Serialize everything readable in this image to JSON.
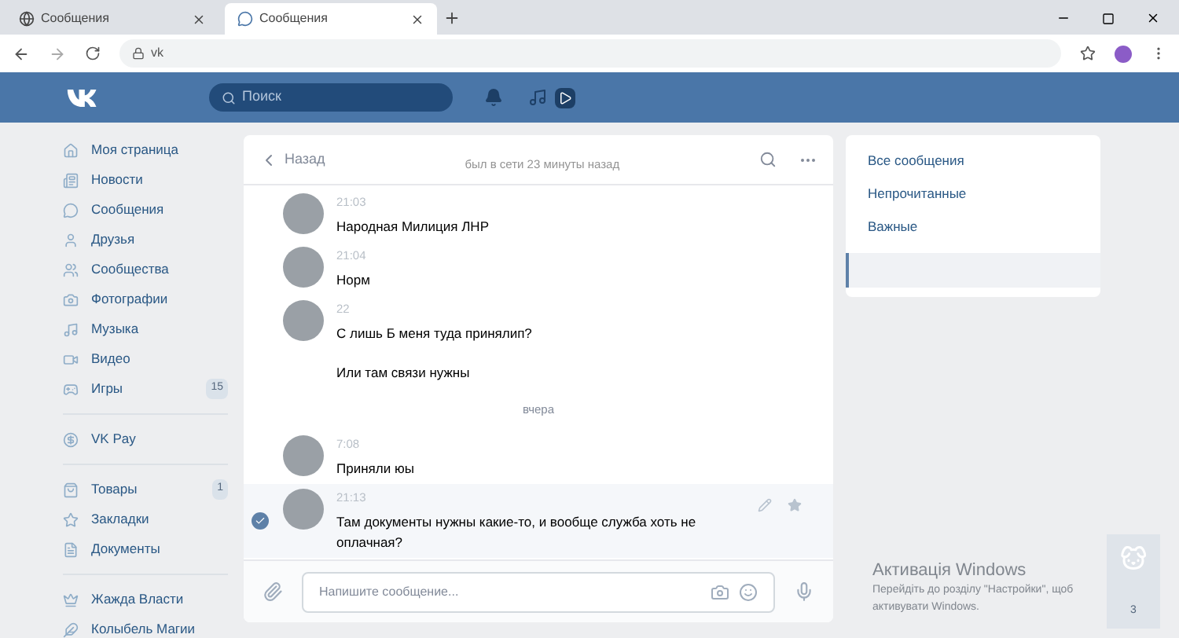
{
  "browser": {
    "tabs": [
      {
        "label": "Сообщения",
        "selected": false
      },
      {
        "label": "Сообщения",
        "selected": true
      }
    ],
    "address": "vk"
  },
  "header": {
    "search": {
      "placeholder": "Поиск"
    }
  },
  "sidebar": {
    "groups": [
      [
        {
          "label": "Моя страница"
        },
        {
          "label": "Новости"
        },
        {
          "label": "Сообщения"
        },
        {
          "label": "Друзья"
        },
        {
          "label": "Сообщества"
        },
        {
          "label": "Фотографии"
        },
        {
          "label": "Музыка"
        },
        {
          "label": "Видео"
        },
        {
          "label": "Игры",
          "count": "15"
        }
      ],
      [
        {
          "label": "VK Pay"
        }
      ],
      [
        {
          "label": "Товары",
          "count": "1"
        },
        {
          "label": "Закладки"
        },
        {
          "label": "Документы"
        }
      ],
      [
        {
          "label": "Жажда Власти"
        },
        {
          "label": "Колыбель Магии"
        }
      ]
    ]
  },
  "chat": {
    "back": "Назад",
    "status": "был в сети 23 минуты назад",
    "items": [
      {
        "kind": "message",
        "time": "21:03",
        "texts": [
          "Народная Милиция ЛНР"
        ],
        "selected": false
      },
      {
        "kind": "message",
        "time": "21:04",
        "texts": [
          "Норм"
        ],
        "selected": false
      },
      {
        "kind": "message",
        "time": "22",
        "texts": [
          "С лишь Б меня туда принялип?",
          "Или там связи нужны"
        ],
        "selected": false
      },
      {
        "kind": "divider",
        "text": "вчера"
      },
      {
        "kind": "message",
        "time": "7:08",
        "texts": [
          "Приняли юы"
        ],
        "selected": false
      },
      {
        "kind": "message",
        "time": "21:13",
        "texts": [
          "Там документы нужны какие-то, и вообще служба хоть не оплачная?"
        ],
        "selected": true
      }
    ],
    "composer": {
      "placeholder": "Напишите сообщение..."
    }
  },
  "filters": [
    {
      "label": "Все сообщения"
    },
    {
      "label": "Непрочитанные"
    },
    {
      "label": "Важные"
    }
  ],
  "windows_activation": {
    "title": "Активація Windows",
    "text": "Перейдіть до розділу \"Настройки\", щоб активувати Windows."
  },
  "chat_widget": {
    "count": "3"
  }
}
